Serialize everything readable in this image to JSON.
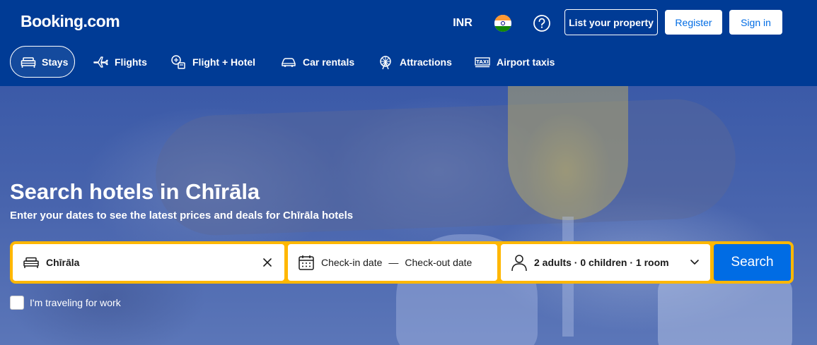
{
  "header": {
    "logo": "Booking.com",
    "currency": "INR",
    "flag_icon": "india-flag-icon",
    "help_icon": "question-icon",
    "list_property": "List your property",
    "register": "Register",
    "sign_in": "Sign in"
  },
  "nav": {
    "tabs": [
      {
        "label": "Stays",
        "icon": "bed-icon",
        "active": true
      },
      {
        "label": "Flights",
        "icon": "plane-icon"
      },
      {
        "label": "Flight + Hotel",
        "icon": "flight-hotel-icon"
      },
      {
        "label": "Car rentals",
        "icon": "car-icon"
      },
      {
        "label": "Attractions",
        "icon": "ferris-wheel-icon"
      },
      {
        "label": "Airport taxis",
        "icon": "taxi-icon"
      }
    ]
  },
  "hero": {
    "title": "Search hotels in Chīrāla",
    "subtitle": "Enter your dates to see the latest prices and deals for Chīrāla hotels"
  },
  "search": {
    "destination": "Chīrāla",
    "checkin_placeholder": "Check-in date",
    "dash": "—",
    "checkout_placeholder": "Check-out date",
    "occupancy": "2 adults · 0 children · 1 room",
    "button": "Search",
    "work_label": "I'm traveling for work"
  },
  "colors": {
    "brand_blue": "#003b95",
    "accent_blue": "#006ce4",
    "search_border": "#ffb700"
  }
}
